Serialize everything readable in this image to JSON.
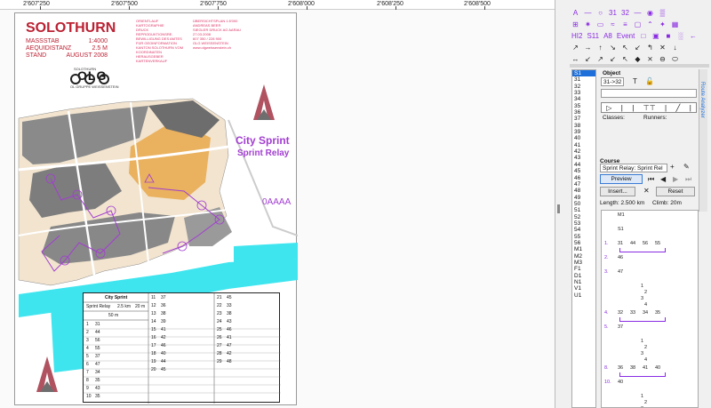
{
  "coords": [
    "2'607'250",
    "2'607'500",
    "2'607'750",
    "2'608'000",
    "2'608'250",
    "2'608'500"
  ],
  "map": {
    "title": "SOLOTHURN",
    "scale_label": "MASSSTAB",
    "scale_value": "1:4000",
    "equidistance_label": "AEQUIDISTANZ",
    "equidistance_value": "2.5 M",
    "stand_label": "STAND",
    "stand_value": "AUGUST 2008",
    "info_labels": [
      "ORIENTLAUF",
      "KARTOGRAPHIE",
      "DRUCK",
      "REPRODUKTIONSRE.",
      "BEWILLIGUNG DES AMTES FÜR GEOINFORMATION KANTON SOLOTHURN VOM",
      "KOORDINATEN",
      "HERAUSGEBER",
      "KARTENVERKAUF"
    ],
    "info_values": [
      "ÜBERSICHTSPLAN 1:5'000",
      "ANDREAS BEER",
      "SIEGLER DRUCK AG AARAU",
      "",
      "27.03.2008",
      "607 350 / 228 900",
      "OLG WEISSENSTEIN",
      "www.olgweissenstein.ch"
    ],
    "club_top": "SOLOTHURN",
    "club_logo": "OLG",
    "club_sub": "OL GRUPPE WEISSENSTEIN",
    "course_title": "City Sprint",
    "course_subtitle": "Sprint Relay",
    "code_text": "0AAAA"
  },
  "description_sheet": {
    "title": "City Sprint",
    "course_name": "Sprint Relay",
    "length": "2.5 km",
    "climb": "20 m",
    "left_rows": [
      [
        "1",
        "31"
      ],
      [
        "2",
        "44"
      ],
      [
        "3",
        "56"
      ],
      [
        "4",
        "55"
      ],
      [
        "5",
        "37"
      ],
      [
        "6",
        "47"
      ],
      [
        "7",
        "34"
      ],
      [
        "8",
        "35"
      ],
      [
        "9",
        "43"
      ],
      [
        "10",
        "35"
      ]
    ],
    "mid_rows": [
      [
        "11",
        "37"
      ],
      [
        "12",
        "36"
      ],
      [
        "13",
        "38"
      ],
      [
        "14",
        "39"
      ],
      [
        "15",
        "41"
      ],
      [
        "16",
        "42"
      ],
      [
        "17",
        "46"
      ],
      [
        "18",
        "40"
      ],
      [
        "19",
        "44"
      ],
      [
        "20",
        "45"
      ]
    ],
    "right_rows": [
      [
        "21",
        "45"
      ],
      [
        "22",
        "33"
      ],
      [
        "23",
        "38"
      ],
      [
        "24",
        "43"
      ],
      [
        "25",
        "46"
      ],
      [
        "26",
        "41"
      ],
      [
        "27",
        "47"
      ],
      [
        "28",
        "42"
      ],
      [
        "29",
        "48"
      ]
    ],
    "finish_note": "50 m"
  },
  "palette": {
    "row1": [
      "A",
      "—",
      "○",
      "31",
      "32",
      "—",
      "◉",
      "▒"
    ],
    "row2": [
      "⊞",
      "✷",
      "▭",
      "≈",
      "≡",
      "▢",
      "⌃",
      "✦",
      "▦"
    ],
    "row3": [
      "HI2",
      "S11",
      "A8",
      "Event",
      "□",
      "▣",
      "■",
      "░",
      "←"
    ],
    "row4": [
      "↗",
      "→",
      "↑",
      "↘",
      "↖",
      "↙",
      "↰",
      "✕",
      "↓"
    ],
    "row5": [
      "↔",
      "↙",
      "↗",
      "↙",
      "↖",
      "◆",
      "⨯",
      "⊖",
      "⬭"
    ]
  },
  "course_list": [
    "S1",
    "31",
    "32",
    "33",
    "34",
    "35",
    "36",
    "37",
    "38",
    "39",
    "40",
    "41",
    "42",
    "43",
    "44",
    "45",
    "46",
    "47",
    "48",
    "49",
    "50",
    "51",
    "52",
    "53",
    "54",
    "55",
    "56",
    "M1",
    "M2",
    "M3",
    "F1",
    "D1",
    "N1",
    "V1",
    "U1"
  ],
  "object": {
    "label": "Object",
    "leg_value": "31->32",
    "classes_label": "Classes:",
    "runners_label": "Runners:"
  },
  "course": {
    "label": "Course",
    "selected": "Sprint Relay: Sprint Rel",
    "preview": "Preview",
    "insert": "Insert...",
    "reset": "Reset",
    "length": "Length: 2.500 km",
    "climb": "Climb: 20m",
    "tab": "Route Analyzer"
  },
  "legs": [
    {
      "num": "",
      "controls": [
        "M1"
      ]
    },
    {
      "num": "",
      "controls": [
        "S1"
      ]
    },
    {
      "num": "1.",
      "controls": [
        "31",
        "44",
        "56",
        "55"
      ]
    },
    {
      "num": "2.",
      "controls": [
        "46"
      ]
    },
    {
      "num": "3.",
      "controls": [
        "47"
      ]
    },
    {
      "num": "",
      "controls": [
        "1",
        "2",
        "3",
        "4"
      ]
    },
    {
      "num": "4.",
      "controls": [
        "32",
        "33",
        "34",
        "35"
      ]
    },
    {
      "num": "5.",
      "controls": [
        "37"
      ]
    },
    {
      "num": "",
      "controls": [
        "1",
        "2",
        "3",
        "4"
      ]
    },
    {
      "num": "8.",
      "controls": [
        "36",
        "38",
        "41",
        "40"
      ]
    },
    {
      "num": "10.",
      "controls": [
        "40"
      ]
    },
    {
      "num": "",
      "controls": [
        "1",
        "2",
        "3",
        "4"
      ]
    }
  ],
  "colors": {
    "accent": "#a23ed1",
    "sea": "#3ee5ef",
    "map_red": "#b23"
  }
}
